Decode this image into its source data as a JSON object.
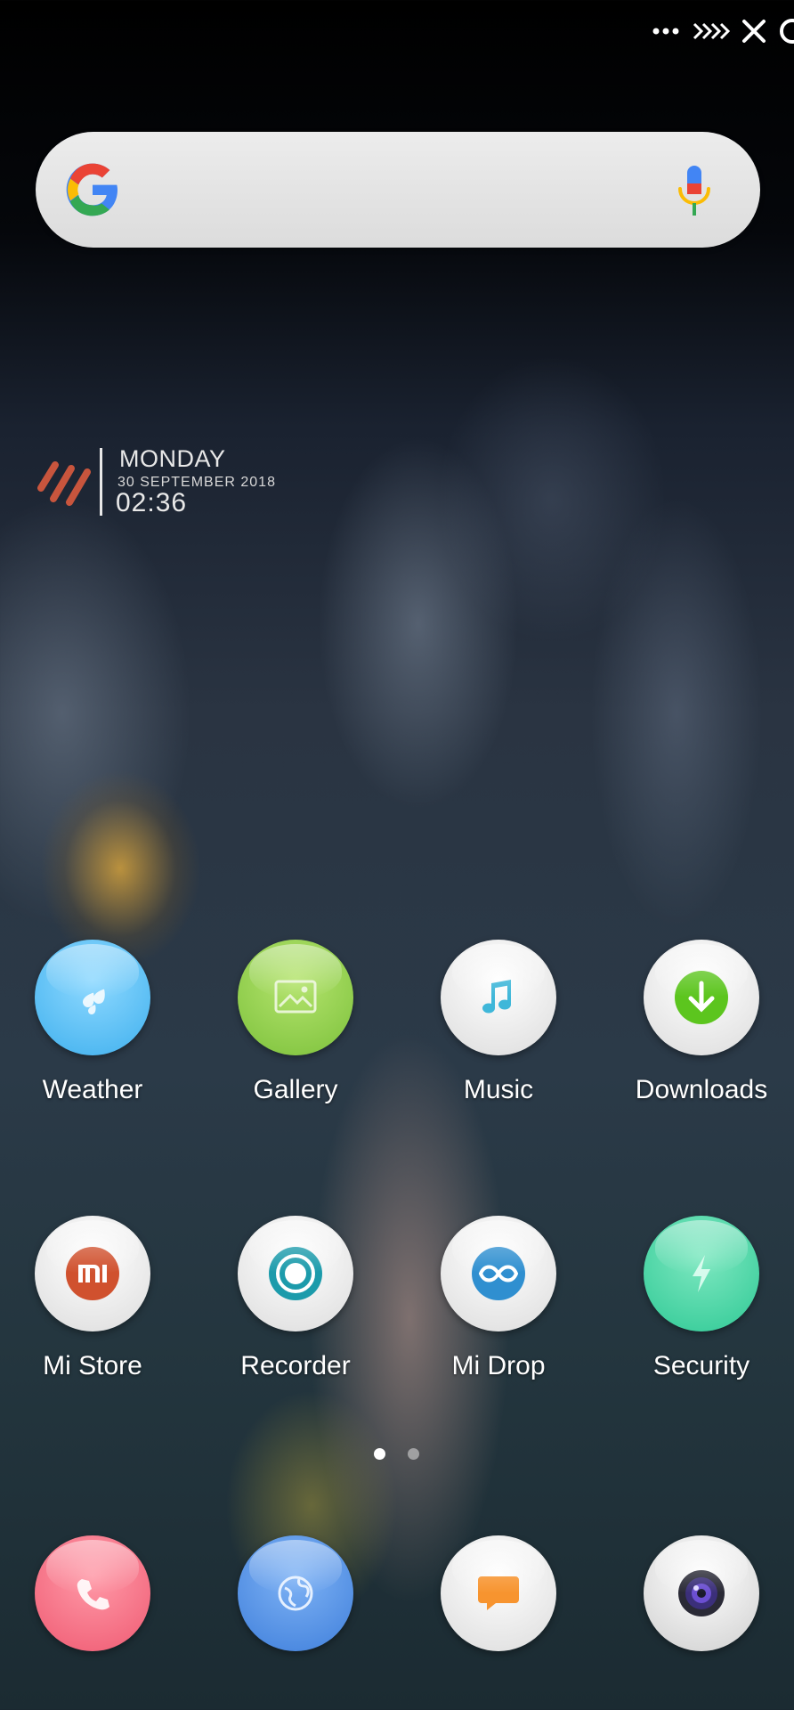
{
  "status_bar": {
    "icons": [
      "more-dots-icon",
      "signal-arrows-icon",
      "no-sim-x-icon",
      "battery-ring-icon"
    ]
  },
  "search_bar": {
    "logo_icon": "google-g-icon",
    "mic_icon": "microphone-icon"
  },
  "clock_widget": {
    "day": "MONDAY",
    "date": "30 SEPTEMBER 2018",
    "time": "02:36",
    "accent_color": "#c8553d"
  },
  "apps": [
    {
      "label": "Weather",
      "icon": "weather-icon",
      "color": "#5ec4f5"
    },
    {
      "label": "Gallery",
      "icon": "gallery-icon",
      "color": "#8fcf4d"
    },
    {
      "label": "Music",
      "icon": "music-note-icon",
      "color": "#f2f2f2"
    },
    {
      "label": "Downloads",
      "icon": "download-icon",
      "color": "#f2f2f2"
    },
    {
      "label": "Mi Store",
      "icon": "mi-store-icon",
      "color": "#f2f2f2"
    },
    {
      "label": "Recorder",
      "icon": "recorder-icon",
      "color": "#f2f2f2"
    },
    {
      "label": "Mi Drop",
      "icon": "mi-drop-icon",
      "color": "#f2f2f2"
    },
    {
      "label": "Security",
      "icon": "security-icon",
      "color": "#3ed2a0"
    }
  ],
  "page_indicator": {
    "pages": 2,
    "active": 1
  },
  "dock": [
    {
      "icon": "phone-icon",
      "color": "#f26a7f"
    },
    {
      "icon": "browser-icon",
      "color": "#4f8fe0"
    },
    {
      "icon": "messages-icon",
      "color": "#f2f2f2"
    },
    {
      "icon": "camera-icon",
      "color": "#e8e8e8"
    }
  ]
}
